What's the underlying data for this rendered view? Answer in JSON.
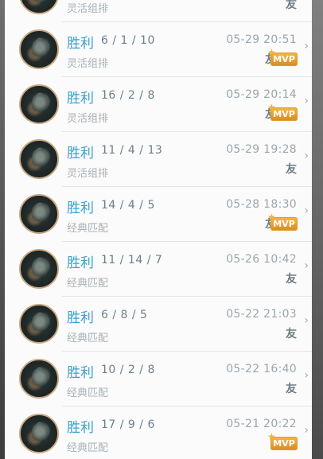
{
  "partial_row": {
    "mode": "灵活组排",
    "friend_badge": "友"
  },
  "matches": [
    {
      "result": "胜利",
      "kda": "6 / 1 / 10",
      "datetime": "05-29 20:51",
      "mode": "灵活组排",
      "friend_badge": "友",
      "mvp": "MVP"
    },
    {
      "result": "胜利",
      "kda": "16 / 2 / 8",
      "datetime": "05-29 20:14",
      "mode": "灵活组排",
      "friend_badge": "友",
      "mvp": "MVP"
    },
    {
      "result": "胜利",
      "kda": "11 / 4 / 13",
      "datetime": "05-29 19:28",
      "mode": "灵活组排",
      "friend_badge": "友",
      "mvp": null
    },
    {
      "result": "胜利",
      "kda": "14 / 4 / 5",
      "datetime": "05-28 18:30",
      "mode": "经典匹配",
      "friend_badge": "友",
      "mvp": "MVP"
    },
    {
      "result": "胜利",
      "kda": "11 / 14 / 7",
      "datetime": "05-26 10:42",
      "mode": "经典匹配",
      "friend_badge": "友",
      "mvp": null
    },
    {
      "result": "胜利",
      "kda": "6 / 8 / 5",
      "datetime": "05-22 21:03",
      "mode": "经典匹配",
      "friend_badge": "友",
      "mvp": null
    },
    {
      "result": "胜利",
      "kda": "10 / 2 / 8",
      "datetime": "05-22 16:40",
      "mode": "经典匹配",
      "friend_badge": "友",
      "mvp": null
    },
    {
      "result": "胜利",
      "kda": "17 / 9 / 6",
      "datetime": "05-21 20:22",
      "mode": "经典匹配",
      "friend_badge": null,
      "mvp": "MVP"
    }
  ],
  "icons": {
    "chevron": "chevron-right-icon",
    "chevron_glyph": "›"
  },
  "colors": {
    "result_win": "#3aa0cd",
    "mvp_badge": "#e59a2c",
    "avatar_ring": "#c9a983"
  }
}
